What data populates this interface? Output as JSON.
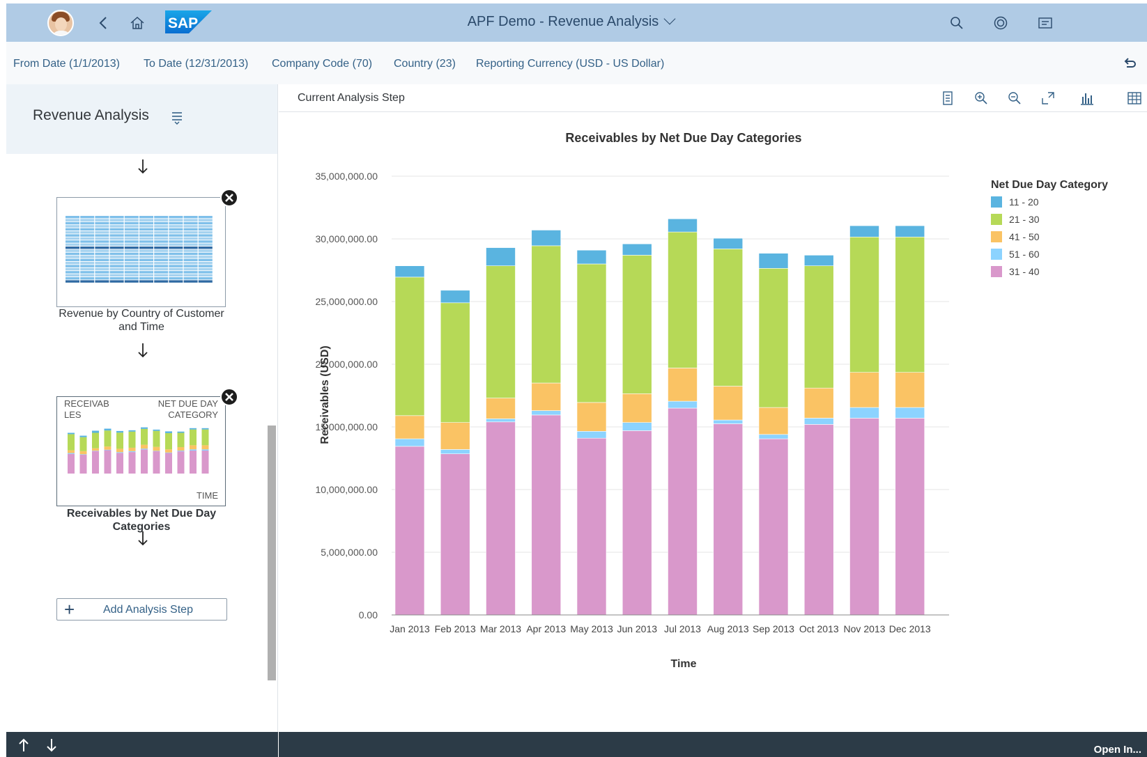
{
  "shell": {
    "title": "APF Demo - Revenue Analysis"
  },
  "filters": [
    "From Date (1/1/2013)",
    "To Date (12/31/2013)",
    "Company Code (70)",
    "Country (23)",
    "Reporting Currency (USD - US Dollar)"
  ],
  "left_panel": {
    "title": "Revenue Analysis",
    "steps": [
      {
        "label": "Revenue by Country of Customer and Time"
      },
      {
        "label": "Receivables by Net Due Day Categories",
        "thumb_y": "RECEIVAB LES",
        "thumb_legend": "NET DUE DAY CATEGORY",
        "thumb_x": "TIME"
      }
    ],
    "add_button": "Add Analysis Step"
  },
  "main": {
    "header": "Current Analysis Step"
  },
  "colors": {
    "11 - 20": "#5ab4e0",
    "21 - 30": "#b6d957",
    "41 - 50": "#fac364",
    "51 - 60": "#8cd3ff",
    "31 - 40": "#d998cb",
    "shell": "#b0cbe5",
    "footer": "#2c3b47"
  },
  "chart_data": {
    "type": "bar",
    "stacked": true,
    "title": "Receivables by Net Due Day Categories",
    "xlabel": "Time",
    "ylabel": "Receivables (USD)",
    "legend_title": "Net Due Day Category",
    "legend_position": "top-right",
    "ylim": [
      0,
      35000000
    ],
    "ytick_step": 5000000,
    "ytick_labels": [
      "0.00",
      "5,000,000.00",
      "10,000,000.00",
      "15,000,000.00",
      "20,000,000.00",
      "25,000,000.00",
      "30,000,000.00",
      "35,000,000.00"
    ],
    "grid": true,
    "categories": [
      "Jan 2013",
      "Feb 2013",
      "Mar 2013",
      "Apr 2013",
      "May 2013",
      "Jun 2013",
      "Jul 2013",
      "Aug 2013",
      "Sep 2013",
      "Oct 2013",
      "Nov 2013",
      "Dec 2013"
    ],
    "stack_order": [
      "31 - 40",
      "51 - 60",
      "41 - 50",
      "21 - 30",
      "11 - 20"
    ],
    "legend_order": [
      "11 - 20",
      "21 - 30",
      "41 - 50",
      "51 - 60",
      "31 - 40"
    ],
    "series": [
      {
        "name": "11 - 20",
        "values": [
          900000,
          1000000,
          1450000,
          1250000,
          1100000,
          900000,
          1050000,
          850000,
          1200000,
          850000,
          900000,
          900000
        ]
      },
      {
        "name": "21 - 30",
        "values": [
          11050000,
          9550000,
          10550000,
          10950000,
          11050000,
          11050000,
          10850000,
          10950000,
          11100000,
          9750000,
          10800000,
          10800000
        ]
      },
      {
        "name": "41 - 50",
        "values": [
          1850000,
          2150000,
          1650000,
          2200000,
          2300000,
          2300000,
          2650000,
          2700000,
          2150000,
          2400000,
          2800000,
          2800000
        ]
      },
      {
        "name": "51 - 60",
        "values": [
          600000,
          350000,
          250000,
          350000,
          550000,
          650000,
          550000,
          300000,
          350000,
          500000,
          850000,
          850000
        ]
      },
      {
        "name": "31 - 40",
        "values": [
          13450000,
          12850000,
          15400000,
          15950000,
          14100000,
          14700000,
          16500000,
          15250000,
          14050000,
          15200000,
          15700000,
          15700000
        ]
      }
    ]
  },
  "footer": {
    "open_in": "Open In..."
  }
}
